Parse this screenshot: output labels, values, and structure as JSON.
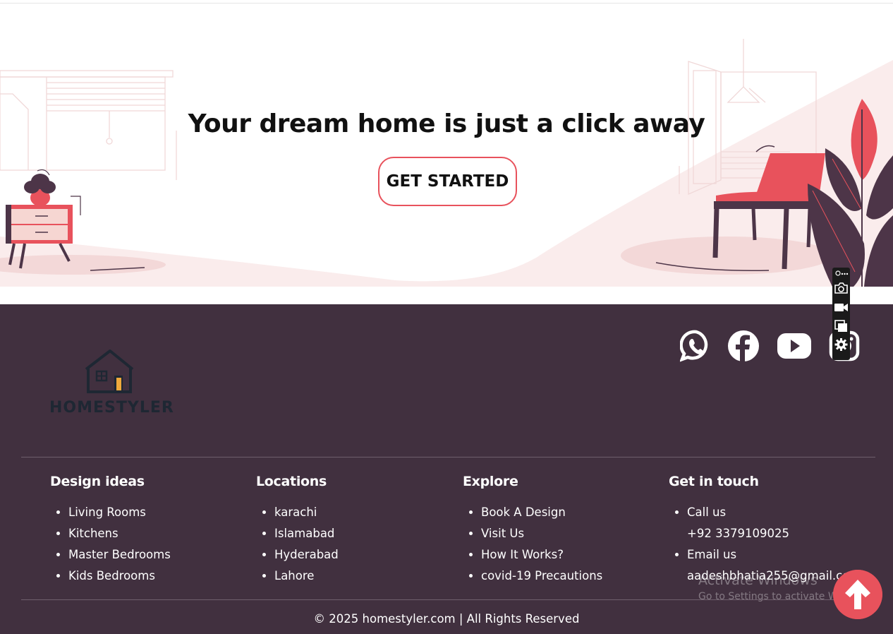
{
  "hero": {
    "title": "Your dream home is just a click away",
    "cta_label": "GET STARTED"
  },
  "footer": {
    "logo_text": "HOMESTYLER",
    "social": [
      "whatsapp-icon",
      "facebook-icon",
      "youtube-icon",
      "instagram-icon"
    ],
    "columns": [
      {
        "heading": "Design ideas",
        "items": [
          "Living Rooms",
          "Kitchens",
          "Master Bedrooms",
          "Kids Bedrooms"
        ]
      },
      {
        "heading": "Locations",
        "items": [
          "karachi",
          "Islamabad",
          "Hyderabad",
          "Lahore"
        ]
      },
      {
        "heading": "Explore",
        "items": [
          "Book A Design",
          "Visit Us",
          "How It Works?",
          "covid-19 Precautions"
        ]
      },
      {
        "heading": "Get in touch",
        "items": [
          "Call us",
          "+92 3379109025",
          "Email us",
          "aadeshbhatia255@gmail.com"
        ]
      }
    ],
    "copyright": "© 2025 homestyler.com | All Rights Reserved"
  },
  "watermark": {
    "title": "Activate Windows",
    "subtitle": "Go to Settings to activate Windows."
  },
  "colors": {
    "footer_bg": "#41303f",
    "accent": "#e8525c",
    "plum": "#4d3548"
  }
}
